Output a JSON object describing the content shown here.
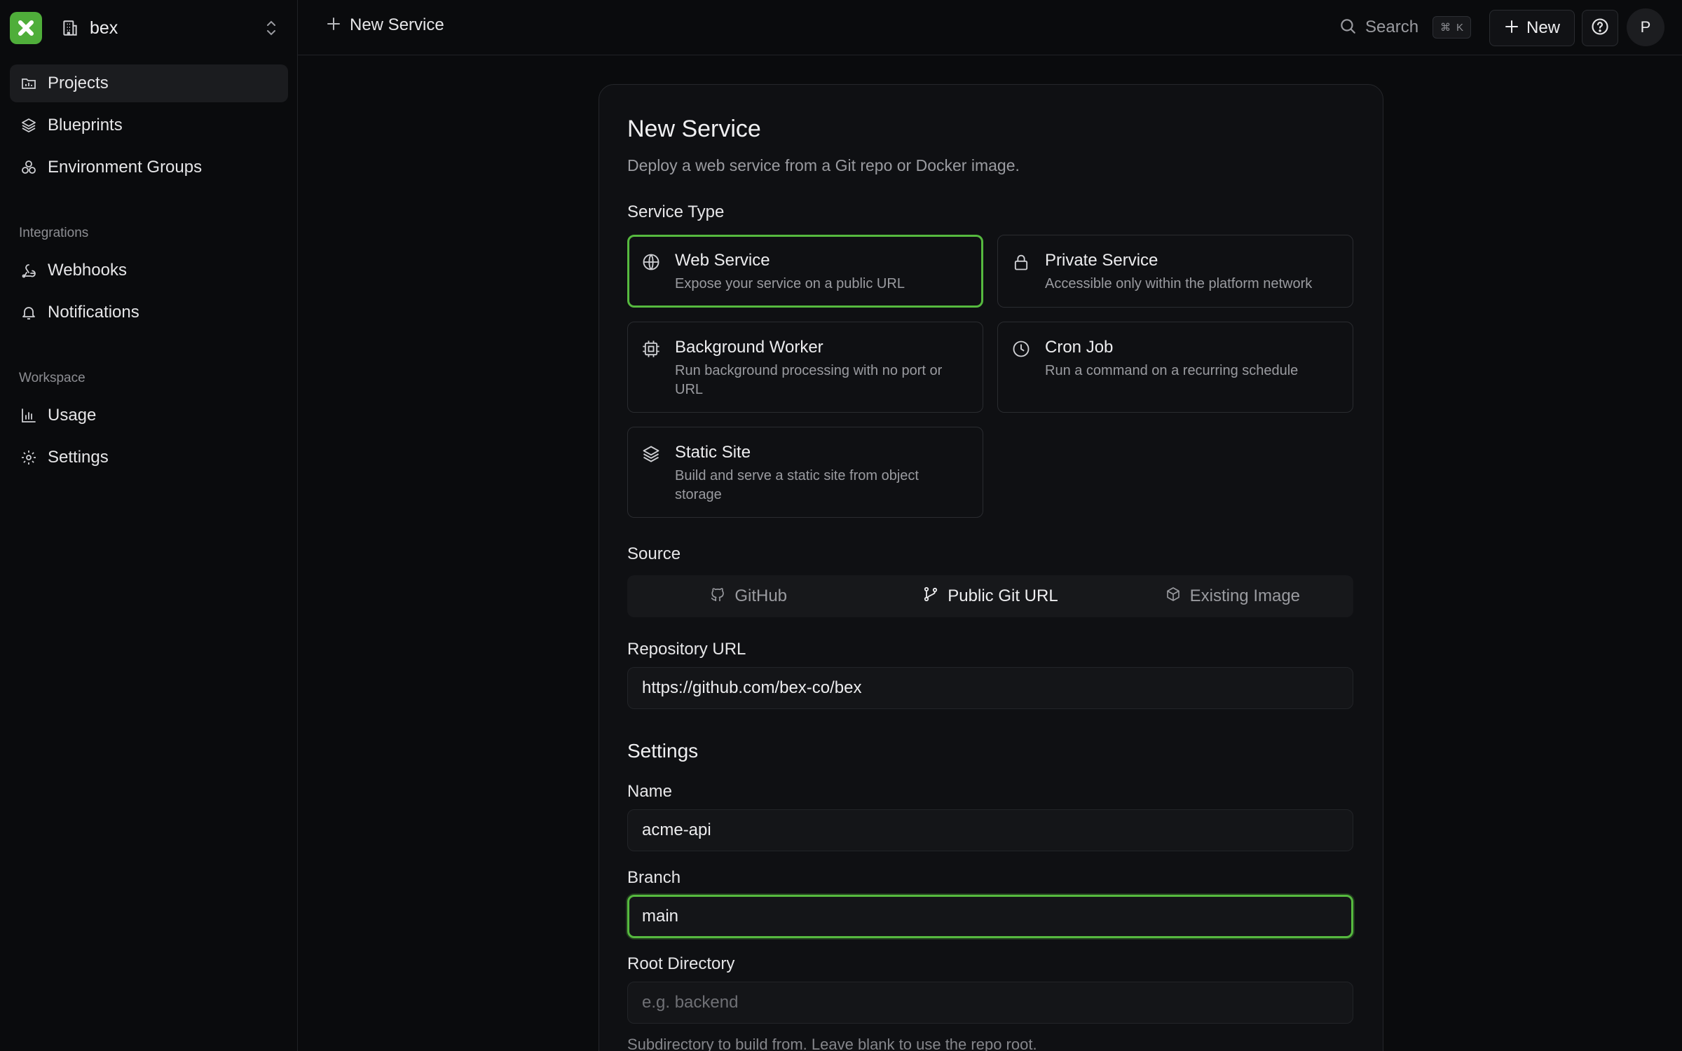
{
  "workspace": {
    "name": "bex"
  },
  "sidebar": {
    "main_items": [
      {
        "label": "Projects",
        "icon": "projects-icon"
      },
      {
        "label": "Blueprints",
        "icon": "layers-icon"
      },
      {
        "label": "Environment Groups",
        "icon": "environment-groups-icon"
      }
    ],
    "integrations_title": "Integrations",
    "integrations_items": [
      {
        "label": "Webhooks",
        "icon": "webhook-icon"
      },
      {
        "label": "Notifications",
        "icon": "bell-icon"
      }
    ],
    "workspace_title": "Workspace",
    "workspace_items": [
      {
        "label": "Usage",
        "icon": "bar-chart-icon"
      },
      {
        "label": "Settings",
        "icon": "gear-icon"
      }
    ]
  },
  "topbar": {
    "crumb": "New Service",
    "search_label": "Search",
    "search_shortcut_cmd": "⌘",
    "search_shortcut_key": "K",
    "new_label": "New",
    "avatar_initial": "P"
  },
  "page": {
    "title": "New Service",
    "subtitle": "Deploy a web service from a Git repo or Docker image.",
    "service_type_label": "Service Type",
    "service_types": [
      {
        "title": "Web Service",
        "desc": "Expose your service on a public URL",
        "icon": "globe-icon",
        "selected": true
      },
      {
        "title": "Private Service",
        "desc": "Accessible only within the platform network",
        "icon": "lock-icon",
        "selected": false
      },
      {
        "title": "Background Worker",
        "desc": "Run background processing with no port or URL",
        "icon": "cpu-icon",
        "selected": false
      },
      {
        "title": "Cron Job",
        "desc": "Run a command on a recurring schedule",
        "icon": "clock-icon",
        "selected": false
      },
      {
        "title": "Static Site",
        "desc": "Build and serve a static site from object storage",
        "icon": "layers-icon",
        "selected": false
      }
    ],
    "source_label": "Source",
    "source_tabs": [
      {
        "label": "GitHub",
        "icon": "github-icon",
        "active": false
      },
      {
        "label": "Public Git URL",
        "icon": "git-branch-icon",
        "active": true
      },
      {
        "label": "Existing Image",
        "icon": "box-icon",
        "active": false
      }
    ],
    "repo_url_label": "Repository URL",
    "repo_url_value": "https://github.com/bex-co/bex",
    "settings_heading": "Settings",
    "name_label": "Name",
    "name_value": "acme-api",
    "branch_label": "Branch",
    "branch_value": "main",
    "root_dir_label": "Root Directory",
    "root_dir_placeholder": "e.g. backend",
    "root_dir_help": "Subdirectory to build from. Leave blank to use the repo root."
  },
  "colors": {
    "accent": "#56b93f",
    "logo": "#4fae3a",
    "background": "#0a0b0d",
    "card": "#0f1013"
  }
}
